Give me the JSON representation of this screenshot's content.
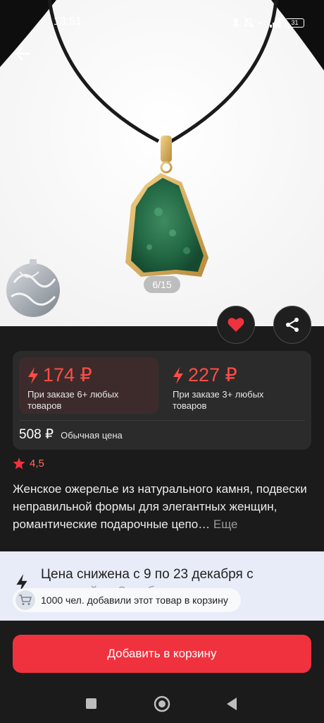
{
  "status": {
    "time": "13:51",
    "battery": "31",
    "network": "4G"
  },
  "gallery": {
    "counter": "6/15"
  },
  "icons": {
    "back": "arrow-left-icon",
    "favorite": "heart-icon",
    "share": "share-icon",
    "lightning": "lightning-icon",
    "star": "star-icon",
    "cart": "cart-icon"
  },
  "prices": {
    "offer1": {
      "price": "174 ₽",
      "note": "При заказе 6+ любых товаров"
    },
    "offer2": {
      "price": "227 ₽",
      "note": "При заказе 3+ любых товаров"
    },
    "regular": {
      "price": "508 ₽",
      "label": "Обычная цена"
    }
  },
  "rating": {
    "value": "4,5"
  },
  "product": {
    "title": "Женское ожерелье из натурального камня, подвески неправильной формы для элегантных женщин, романтические подарочные цепо…",
    "more": "Еще"
  },
  "promo": {
    "text_main": "Цена снижена с 9 по 23 декабря с ",
    "text_fade": "корзиной от 3 любых товаров",
    "basket_note": "1000 чел. добавили этот товар в корзину"
  },
  "cta": {
    "add_to_cart": "Добавить в корзину"
  },
  "colors": {
    "accent": "#f0323f",
    "price": "#ff4d45",
    "promo_bg": "#e7ecf8"
  }
}
